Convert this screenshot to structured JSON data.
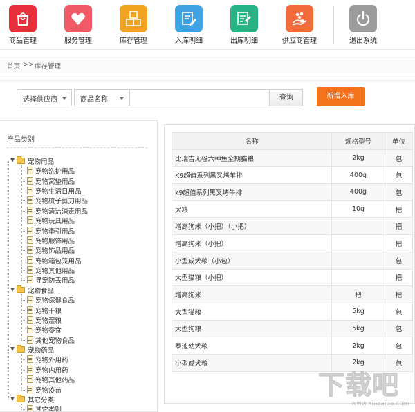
{
  "toolbar": {
    "items": [
      {
        "label": "商品管理",
        "icon": "shopping-bag-icon",
        "color": "#e8303d"
      },
      {
        "label": "服务管理",
        "icon": "heart-icon",
        "color": "#ef5a66"
      },
      {
        "label": "库存管理",
        "icon": "boxes-icon",
        "color": "#f0a221"
      },
      {
        "label": "入库明细",
        "icon": "inbound-form-icon",
        "color": "#3fa2e3"
      },
      {
        "label": "出库明细",
        "icon": "outbound-form-icon",
        "color": "#27b386"
      },
      {
        "label": "供应商管理",
        "icon": "supplier-icon",
        "color": "#f26b3a"
      },
      {
        "label": "退出系统",
        "icon": "power-icon",
        "color": "#9c9c9c"
      }
    ]
  },
  "breadcrumb": {
    "home": "首页",
    "separator": ">>",
    "current": "库存管理"
  },
  "search": {
    "supplier_select": "选择供应商",
    "field_select": "商品名称",
    "keyword_value": "",
    "query_label": "查询",
    "add_label": "新增入库",
    "add_color": "#f5721d"
  },
  "tree": {
    "title": "产品类别",
    "groups": [
      {
        "label": "宠物用品",
        "children": [
          "宠物洗护用品",
          "宠物窝垫用品",
          "宠物生活日用品",
          "宠物梳子剪刀用品",
          "宠物清洁消毒用品",
          "宠物玩具用品",
          "宠物牵引用品",
          "宠物服饰用品",
          "宠物饰品用品",
          "宠物箱包笼用品",
          "宠物其他用品",
          "寻宠防丢用品"
        ]
      },
      {
        "label": "宠物食品",
        "children": [
          "宠物保健食品",
          "宠物干粮",
          "宠物湿粮",
          "宠物零食",
          "其他宠物食品"
        ]
      },
      {
        "label": "宠物药品",
        "children": [
          "宠物外用药",
          "宠物内用药",
          "宠物其他药品",
          "宠物疫苗"
        ]
      },
      {
        "label": "其它分类",
        "children": [
          "其它类别"
        ]
      }
    ]
  },
  "table": {
    "headers": [
      "名称",
      "规格型号",
      "单位"
    ],
    "rows": [
      [
        "比瑞吉无谷六种鱼全期猫粮",
        "2kg",
        "包"
      ],
      [
        "K9超值系列黑叉烤羊排",
        "400g",
        "包"
      ],
      [
        "k9超值系列黑叉烤牛排",
        "400g",
        "包"
      ],
      [
        "犬粮",
        "10g",
        "把"
      ],
      [
        "增高狗米（小把）（小把）",
        "",
        "把"
      ],
      [
        "增高狗米（小把）",
        "",
        "把"
      ],
      [
        "小型成犬粮（小包）",
        "",
        "包"
      ],
      [
        "大型猫粮（小把）",
        "",
        "把"
      ],
      [
        "增高狗米",
        "把",
        "把"
      ],
      [
        "大型猫粮",
        "5kg",
        "包"
      ],
      [
        "大型狗粮",
        "5kg",
        "包"
      ],
      [
        "泰迪幼犬粮",
        "2kg",
        "包"
      ],
      [
        "小型成犬粮",
        "2kg",
        "包"
      ]
    ]
  },
  "watermark": {
    "logo": "下载吧",
    "url": "www.xiazaiba.com"
  }
}
